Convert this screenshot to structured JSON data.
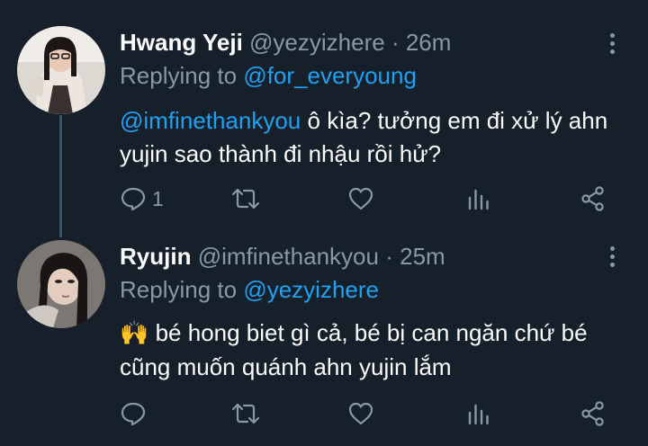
{
  "tweets": [
    {
      "name": "Hwang Yeji",
      "handle": "@yezyizhere",
      "separator": "·",
      "time": "26m",
      "replying_prefix": "Replying to",
      "replying_to": "@for_everyoung",
      "text_mention": "@imfinethankyou",
      "text_body": " ô kìa? tưởng em đi xử lý ahn yujin sao thành đi nhậu rồi hử?",
      "reply_count": "1",
      "retweet_count": "",
      "like_count": ""
    },
    {
      "name": "Ryujin",
      "handle": "@imfinethankyou",
      "separator": "·",
      "time": "25m",
      "replying_prefix": "Replying to",
      "replying_to": "@yezyizhere",
      "emoji": "🙌",
      "text_body": " bé hong biet gì cả, bé bị can ngăn chứ bé cũng muốn quánh ahn yujin lắm",
      "reply_count": "",
      "retweet_count": "",
      "like_count": ""
    }
  ],
  "icons": {
    "reply": "reply-icon",
    "retweet": "retweet-icon",
    "like": "heart-icon",
    "analytics": "analytics-icon",
    "share": "share-icon",
    "more": "more-icon"
  },
  "colors": {
    "background": "#15202b",
    "text": "#ffffff",
    "secondary": "#8899a6",
    "link": "#1da1f2",
    "thread_line": "#3d5466"
  }
}
